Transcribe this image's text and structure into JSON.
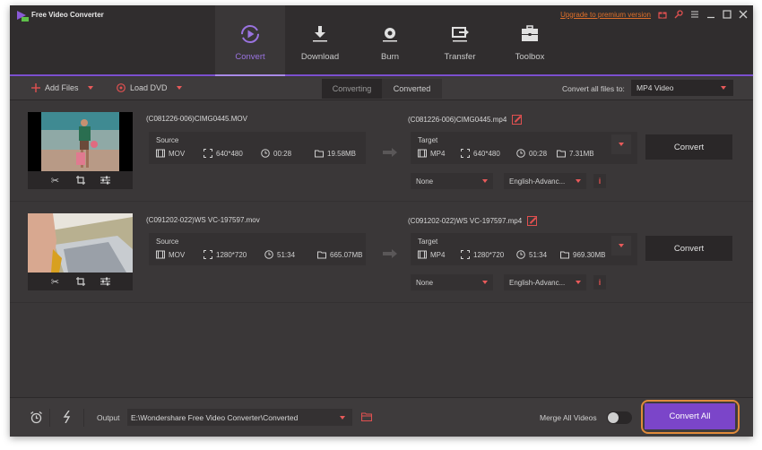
{
  "app": {
    "title": "Free Video Converter",
    "upgrade_link": "Upgrade to premium version",
    "accent_color": "#7b45c9",
    "highlight_color": "#e05050"
  },
  "nav": {
    "tabs": [
      {
        "label": "Convert",
        "icon": "convert-icon",
        "active": true
      },
      {
        "label": "Download",
        "icon": "download-icon",
        "active": false
      },
      {
        "label": "Burn",
        "icon": "burn-icon",
        "active": false
      },
      {
        "label": "Transfer",
        "icon": "transfer-icon",
        "active": false
      },
      {
        "label": "Toolbox",
        "icon": "toolbox-icon",
        "active": false
      }
    ]
  },
  "toolbar": {
    "add_files": "Add Files",
    "load_dvd": "Load DVD",
    "segments": [
      "Converting",
      "Converted"
    ],
    "active_segment": "Converting",
    "convert_all_label": "Convert all files to:",
    "format": "MP4 Video"
  },
  "files": [
    {
      "source_name": "(C081226-006)CIMG0445.MOV",
      "source": {
        "label": "Source",
        "format": "MOV",
        "resolution": "640*480",
        "duration": "00:28",
        "size": "19.58MB"
      },
      "target_name": "(C081226-006)CIMG0445.mp4",
      "target": {
        "label": "Target",
        "format": "MP4",
        "resolution": "640*480",
        "duration": "00:28",
        "size": "7.31MB"
      },
      "subtitle": "None",
      "audio": "English-Advanc...",
      "convert_label": "Convert"
    },
    {
      "source_name": "(C091202-022)WS VC-197597.mov",
      "source": {
        "label": "Source",
        "format": "MOV",
        "resolution": "1280*720",
        "duration": "51:34",
        "size": "665.07MB"
      },
      "target_name": "(C091202-022)WS VC-197597.mp4",
      "target": {
        "label": "Target",
        "format": "MP4",
        "resolution": "1280*720",
        "duration": "51:34",
        "size": "969.30MB"
      },
      "subtitle": "None",
      "audio": "English-Advanc...",
      "convert_label": "Convert"
    }
  ],
  "footer": {
    "output_label": "Output",
    "output_path": "E:\\Wondershare Free Video Converter\\Converted",
    "merge_label": "Merge All Videos",
    "merge_enabled": false,
    "convert_all": "Convert All"
  }
}
